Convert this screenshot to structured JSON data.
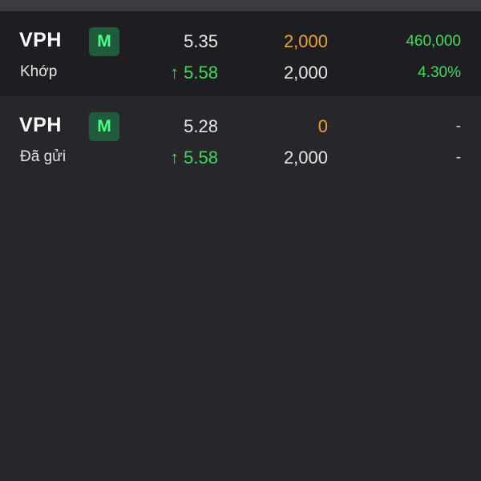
{
  "orders": [
    {
      "symbol": "VPH",
      "badge": "M",
      "status": "Khớp",
      "order_price": "5.35",
      "market_price": "5.58",
      "market_arrow": "↑",
      "matched_qty": "2,000",
      "order_qty": "2,000",
      "value": "460,000",
      "percent": "4.30%"
    },
    {
      "symbol": "VPH",
      "badge": "M",
      "status": "Đã gửi",
      "order_price": "5.28",
      "market_price": "5.58",
      "market_arrow": "↑",
      "matched_qty": "0",
      "order_qty": "2,000",
      "value": "-",
      "percent": "-"
    }
  ],
  "colors": {
    "background": "#27272b",
    "row_highlight": "#1e1e22",
    "up_green": "#3ddc5a",
    "matched_orange": "#f0a033",
    "badge_bg": "#1f5b3a",
    "badge_text": "#4cff88"
  },
  "icons": {
    "up_arrow": "arrow-up-icon"
  }
}
